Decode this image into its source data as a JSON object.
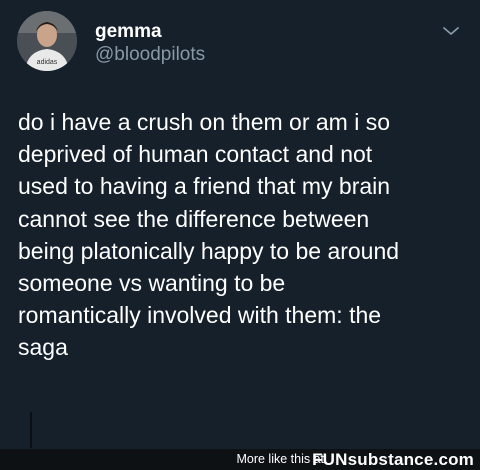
{
  "tweet": {
    "display_name": "gemma",
    "handle": "@bloodpilots",
    "text": "do i have a crush on them or am i so\ndeprived of human contact and not\nused to having a friend that my brain\ncannot see the difference between\nbeing platonically happy to be around\nsomeone vs wanting to be\nromantically involved with them: the\nsaga",
    "shirt_logo_text": "adidas"
  },
  "watermark": {
    "label": "More like this at",
    "brand_fun": "FUN",
    "brand_substance": "substance",
    "brand_dot": ".",
    "brand_com": "com"
  },
  "colors": {
    "background": "#15202b",
    "text_primary": "#ffffff",
    "text_secondary": "#8899a6",
    "footer_background": "#0e1114"
  },
  "icons": {
    "menu": "chevron-down-icon",
    "avatar": "profile-photo"
  }
}
